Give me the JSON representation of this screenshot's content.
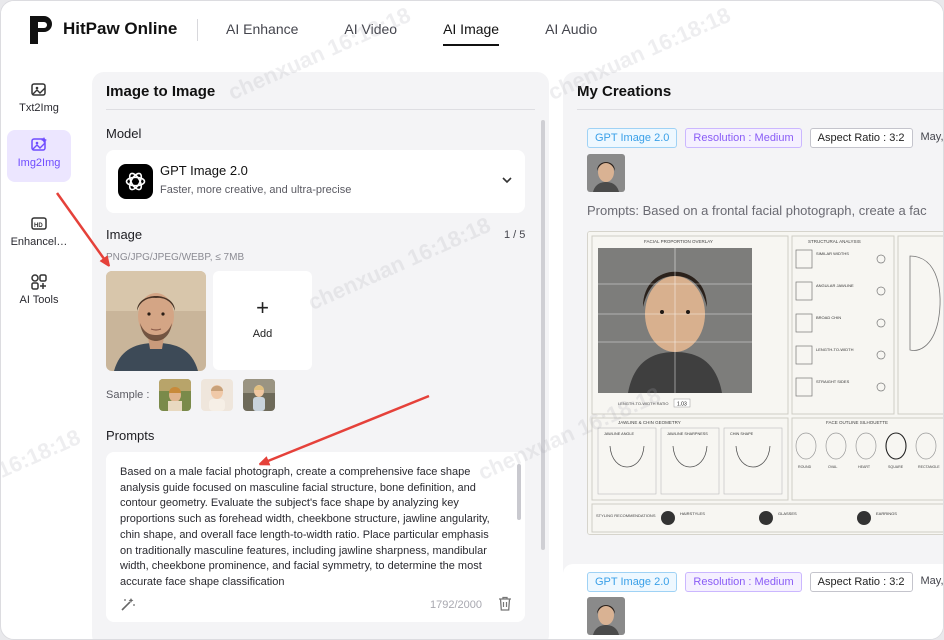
{
  "app": {
    "brand": "HitPaw Online"
  },
  "nav": [
    {
      "label": "AI Enhance",
      "active": false
    },
    {
      "label": "AI Video",
      "active": false
    },
    {
      "label": "AI Image",
      "active": true
    },
    {
      "label": "AI Audio",
      "active": false
    }
  ],
  "rail": [
    {
      "label": "Txt2Img",
      "icon": "text-to-image-icon",
      "active": false
    },
    {
      "label": "Img2Img",
      "icon": "image-to-image-icon",
      "active": true
    },
    {
      "label": "Enhancel…",
      "icon": "enhancer-icon",
      "active": false
    },
    {
      "label": "AI Tools",
      "icon": "tools-icon",
      "active": false
    }
  ],
  "left_panel": {
    "title": "Image to Image",
    "model_label": "Model",
    "model": {
      "name": "GPT Image 2.0",
      "description": "Faster, more creative, and ultra-precise"
    },
    "image_label": "Image",
    "image_count": "1 / 5",
    "image_hint": "PNG/JPG/JPEG/WEBP, ≤ 7MB",
    "add_label": "Add",
    "sample_label": "Sample :",
    "prompts_label": "Prompts",
    "prompt_text": "Based on a male facial photograph, create a comprehensive face shape analysis guide focused on masculine facial structure, bone definition, and contour geometry. Evaluate the subject's face shape by analyzing key proportions such as forehead width, cheekbone structure, jawline angularity, chin shape, and overall face length-to-width ratio. Place particular emphasis on traditionally masculine features, including jawline sharpness, mandibular width, cheekbone prominence, and facial symmetry, to determine the most accurate face shape classification",
    "char_count": "1792/2000"
  },
  "right_panel": {
    "title": "My Creations",
    "cards": [
      {
        "model_tag": "GPT Image 2.0",
        "resolution_tag": "Resolution : Medium",
        "aspect_tag": "Aspect Ratio : 3:2",
        "date": "May,",
        "prompt": "Prompts: Based on a frontal facial photograph, create a fac",
        "sheet": {
          "overlay_title": "FACIAL PROPORTION OVERLAY",
          "structural_title": "STRUCTURAL ANALYSIS",
          "structural_items": [
            "SIMILAR WIDTHS",
            "ANGULAR JAWLINE",
            "BROAD CHIN",
            "LENGTH-TO-WIDTH",
            "STRAIGHT SIDES"
          ],
          "ratio_label": "LENGTH-TO-WIDTH RATIO",
          "ratio_value": "1.03",
          "jaw_title": "JAWLINE & CHIN GEOMETRY",
          "jaw_items": [
            "JAWLINE ANGLE",
            "JAWLINE SHARPNESS",
            "CHIN SHAPE"
          ],
          "silhouette_title": "FACE OUTLINE SILHOUETTE",
          "silhouettes": [
            "ROUND",
            "OVAL",
            "HEART",
            "SQUARE",
            "RECTANGLE"
          ],
          "styling_label": "STYLING RECOMMENDATIONS",
          "styling_items": [
            "HAIRSTYLES",
            "GLASSES",
            "EARRINGS"
          ]
        }
      },
      {
        "model_tag": "GPT Image 2.0",
        "resolution_tag": "Resolution : Medium",
        "aspect_tag": "Aspect Ratio : 3:2",
        "date": "May,"
      }
    ]
  },
  "watermark": [
    "chenxuan 16:18:18",
    "chenxuan 16:18:18",
    "chenxuan 16:18:18",
    "chenxuan 16:18:18",
    "16:18:18"
  ],
  "colors": {
    "accent": "#6f4cff",
    "arrow": "#e5413a",
    "model_tag": "#3aa0e8",
    "resolution_tag": "#8a5cf6"
  }
}
